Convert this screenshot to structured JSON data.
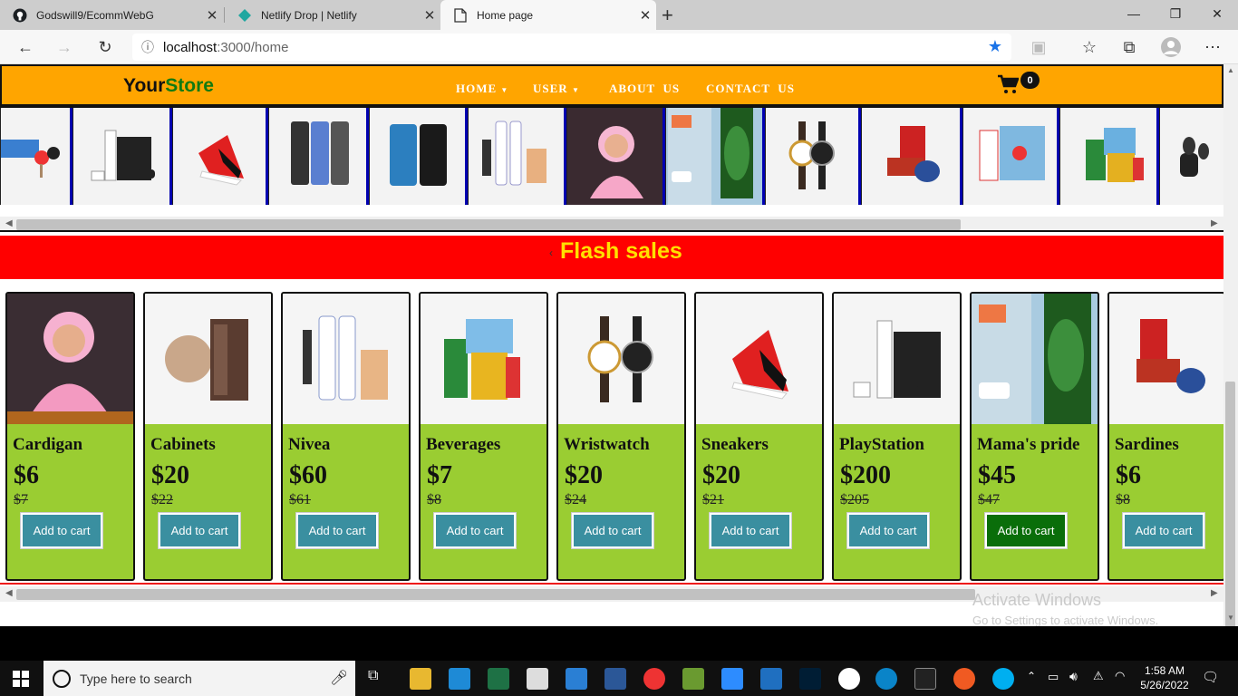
{
  "browser": {
    "tabs": [
      {
        "title": "Godswill9/EcommWebG",
        "icon": "github-icon",
        "active": false
      },
      {
        "title": "Netlify Drop | Netlify",
        "icon": "netlify-icon",
        "active": false
      },
      {
        "title": "Home page",
        "icon": "page-icon",
        "active": true
      }
    ],
    "new_tab": "+",
    "address": {
      "host": "localhost",
      "path": ":3000/home"
    },
    "window_controls": {
      "minimize": "—",
      "maximize": "❐",
      "close": "✕"
    }
  },
  "site": {
    "logo": {
      "part1": "Your",
      "part2": "Store"
    },
    "nav": [
      {
        "label": "HOME",
        "dropdown": true
      },
      {
        "label": "USER",
        "dropdown": true
      },
      {
        "label": "ABOUT  US",
        "dropdown": false
      },
      {
        "label": "CONTACT  US",
        "dropdown": false
      }
    ],
    "cart_count": "0"
  },
  "carousel": {
    "items": [
      "table-tennis",
      "playstation",
      "sneakers",
      "phones",
      "samsung-phones",
      "nivea",
      "cardigan",
      "mamas-pride",
      "wristwatch",
      "sardines",
      "cabinets-kids",
      "beverages",
      "earbuds"
    ]
  },
  "flash_sales": {
    "title": "Flash sales",
    "arrow": "‹",
    "products": [
      {
        "name": "Cardigan",
        "price": "$6",
        "old_price": "$7",
        "button": "Add to cart"
      },
      {
        "name": "Cabinets",
        "price": "$20",
        "old_price": "$22",
        "button": "Add to cart"
      },
      {
        "name": "Nivea",
        "price": "$60",
        "old_price": "$61",
        "button": "Add to cart"
      },
      {
        "name": "Beverages",
        "price": "$7",
        "old_price": "$8",
        "button": "Add to cart"
      },
      {
        "name": "Wristwatch",
        "price": "$20",
        "old_price": "$24",
        "button": "Add to cart"
      },
      {
        "name": "Sneakers",
        "price": "$20",
        "old_price": "$21",
        "button": "Add to cart"
      },
      {
        "name": "PlayStation",
        "price": "$200",
        "old_price": "$205",
        "button": "Add to cart"
      },
      {
        "name": "Mama's pride",
        "price": "$45",
        "old_price": "$47",
        "button": "Add to cart"
      },
      {
        "name": "Sardines",
        "price": "$6",
        "old_price": "$8",
        "button": "Add to cart"
      }
    ]
  },
  "watermark": {
    "line1": "Activate Windows",
    "line2": "Go to Settings to activate Windows."
  },
  "taskbar": {
    "search_placeholder": "Type here to search",
    "time": "1:58 AM",
    "date": "5/26/2022"
  },
  "colors": {
    "navbar": "#ffa500",
    "flash": "#ff0000",
    "card": "#9acd32",
    "button": "#3a8fa0",
    "button_active": "#0a6e0a"
  }
}
